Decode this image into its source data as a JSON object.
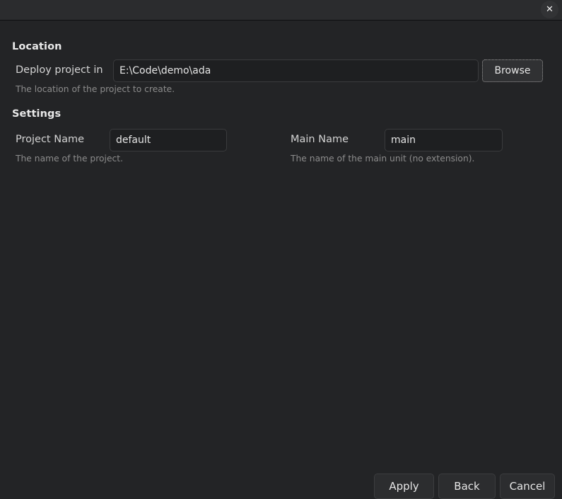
{
  "titlebar": {
    "title": "",
    "close_icon": "close-icon",
    "close_glyph": "✕"
  },
  "sections": {
    "location": {
      "heading": "Location",
      "field_label": "Deploy project in",
      "path_value": "E:\\Code\\demo\\ada",
      "path_placeholder": "",
      "browse_label": "Browse",
      "help": "The location of the project to create."
    },
    "settings": {
      "heading": "Settings",
      "project": {
        "label": "Project Name",
        "value": "default",
        "placeholder": "",
        "help": "The name of the project."
      },
      "main": {
        "label": "Main Name",
        "value": "main",
        "placeholder": "",
        "help": "The name of the main unit (no extension)."
      }
    }
  },
  "footer": {
    "apply_label": "Apply",
    "back_label": "Back",
    "cancel_label": "Cancel"
  },
  "colors": {
    "background": "#232426",
    "titlebar": "#2b2c2e",
    "input_background": "#1e1f21",
    "input_border": "#3a3b3d",
    "text_primary": "#e6e6e6",
    "text_muted": "#8c8c8c",
    "button_background": "#2c2d2f"
  }
}
